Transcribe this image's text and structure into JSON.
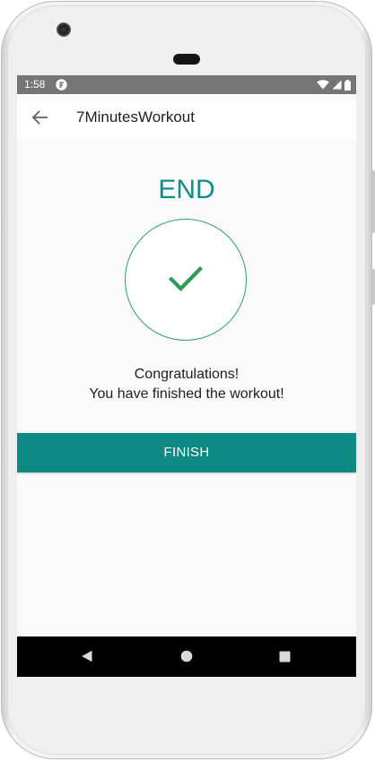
{
  "status_bar": {
    "time": "1:58",
    "app_icon": "notification-app-icon",
    "icons": [
      "wifi-icon",
      "signal-icon",
      "battery-icon"
    ]
  },
  "toolbar": {
    "back_icon": "arrow-back-icon",
    "title": "7MinutesWorkout"
  },
  "main": {
    "end_title": "END",
    "check_icon": "checkmark-icon",
    "congrats_line1": "Congratulations!",
    "congrats_line2": "You have finished the workout!",
    "finish_label": "FINISH"
  },
  "nav_bar": {
    "icons": [
      "back-triangle-icon",
      "home-circle-icon",
      "recents-square-icon"
    ]
  },
  "colors": {
    "accent": "#0e8e8a",
    "button": "#0e8a85",
    "check": "#2e9a55",
    "status_bar": "#757575",
    "background": "#fafafa"
  }
}
